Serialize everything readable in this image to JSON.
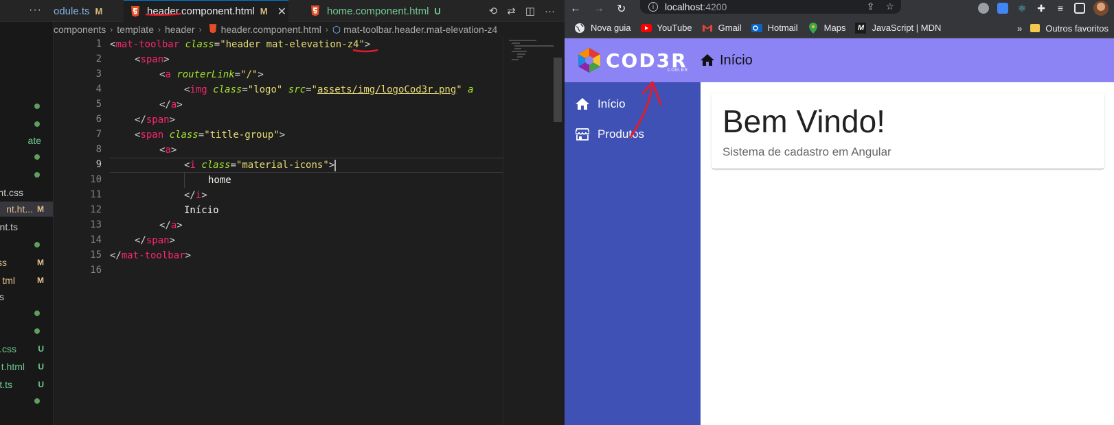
{
  "editor": {
    "tabs": [
      {
        "name": "odule.ts",
        "status": "M"
      },
      {
        "name": "header.component.html",
        "status": "M"
      },
      {
        "name": "home.component.html",
        "status": "U"
      }
    ],
    "breadcrumb": [
      "components",
      "template",
      "header",
      "header.component.html",
      "mat-toolbar.header.mat-elevation-z4"
    ],
    "explorer": [
      {
        "name": "ate",
        "status": ""
      },
      {
        "name": "nt.css",
        "status": ""
      },
      {
        "name": "nt.ht...",
        "status": "M"
      },
      {
        "name": "nt.ts",
        "status": ""
      },
      {
        "name": "ss",
        "status": "M"
      },
      {
        "name": "tml",
        "status": "M"
      },
      {
        "name": "s",
        "status": ""
      },
      {
        "name": "t.css",
        "status": "U"
      },
      {
        "name": "t.html",
        "status": "U"
      },
      {
        "name": "t.ts",
        "status": "U"
      }
    ],
    "line_numbers": [
      "1",
      "2",
      "3",
      "4",
      "5",
      "6",
      "7",
      "8",
      "9",
      "10",
      "11",
      "12",
      "13",
      "14",
      "15",
      "16"
    ],
    "code": {
      "l1": {
        "open": "<",
        "tag": "mat-toolbar",
        "attr": "class",
        "eq": "=",
        "val_a": "\"header mat-elevation-",
        "val_b": "z4",
        "val_c": "\"",
        "close": ">"
      },
      "l2": {
        "open": "<",
        "tag": "span",
        "close": ">"
      },
      "l3": {
        "open": "<",
        "tag": "a",
        "attr": "routerLink",
        "eq": "=",
        "val": "\"/\"",
        "close": ">"
      },
      "l4": {
        "open": "<",
        "tag": "img",
        "attr": "class",
        "eq": "=",
        "val": "\"logo\"",
        "attr2": "src",
        "eq2": "=",
        "val2a": "\"",
        "val2b": "assets/img/logoCod3r.png",
        "val2c": "\"",
        "attr3": "a"
      },
      "l5": {
        "open": "</",
        "tag": "a",
        "close": ">"
      },
      "l6": {
        "open": "</",
        "tag": "span",
        "close": ">"
      },
      "l7": {
        "open": "<",
        "tag": "span",
        "attr": "class",
        "eq": "=",
        "val": "\"title-group\"",
        "close": ">"
      },
      "l8": {
        "open": "<",
        "tag": "a",
        "close": ">"
      },
      "l9": {
        "open": "<",
        "tag": "i",
        "attr": "class",
        "eq": "=",
        "val": "\"material-icons\"",
        "close": ">"
      },
      "l10": {
        "text": "home"
      },
      "l11": {
        "open": "</",
        "tag": "i",
        "close": ">"
      },
      "l12": {
        "text": "Início"
      },
      "l13": {
        "open": "</",
        "tag": "a",
        "close": ">"
      },
      "l14": {
        "open": "</",
        "tag": "span",
        "close": ">"
      },
      "l15": {
        "open": "</",
        "tag": "mat-toolbar",
        "close": ">"
      }
    }
  },
  "browser": {
    "url_host": "localhost",
    "url_port": ":4200",
    "bookmarks": [
      "Nova guia",
      "YouTube",
      "Gmail",
      "Hotmail",
      "Maps",
      "JavaScript | MDN"
    ],
    "overflow": "»",
    "other_favorites": "Outros favoritos"
  },
  "app": {
    "logo": "COD3R",
    "logo_sub": "COM.BR",
    "toolbar_title": "Início",
    "nav": [
      {
        "label": "Início",
        "icon": "home-icon"
      },
      {
        "label": "Produtos",
        "icon": "storefront-icon"
      }
    ],
    "card_title": "Bem Vindo!",
    "card_subtitle": "Sistema de cadastro em Angular"
  },
  "colors": {
    "toolbar": "#8c83f5",
    "sidenav": "#3f51b5",
    "annotation": "#e11d2b"
  }
}
